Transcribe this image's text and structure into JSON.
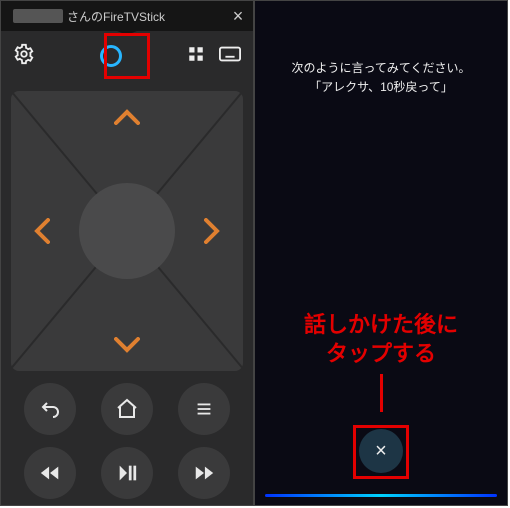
{
  "left": {
    "device_title_suffix": "さんのFireTVStick",
    "close_glyph": "×",
    "icons": {
      "settings": "gear-icon",
      "alexa_ring_color": "#28b6ff",
      "apps": "grid-icon",
      "keyboard": "keyboard-icon"
    },
    "dpad": {
      "directions": [
        "up",
        "down",
        "left",
        "right"
      ],
      "arrow_color": "#e08030"
    },
    "buttons_row1": [
      "back",
      "home",
      "menu"
    ],
    "buttons_row2": [
      "rewind",
      "play-pause",
      "fast-forward"
    ]
  },
  "right": {
    "prompt_line1": "次のように言ってみてください。",
    "prompt_line2": "「アレクサ、10秒戻って」",
    "callout_line1": "話しかけた後に",
    "callout_line2": "タップする",
    "close_glyph": "×",
    "callout_color": "#e30000"
  }
}
